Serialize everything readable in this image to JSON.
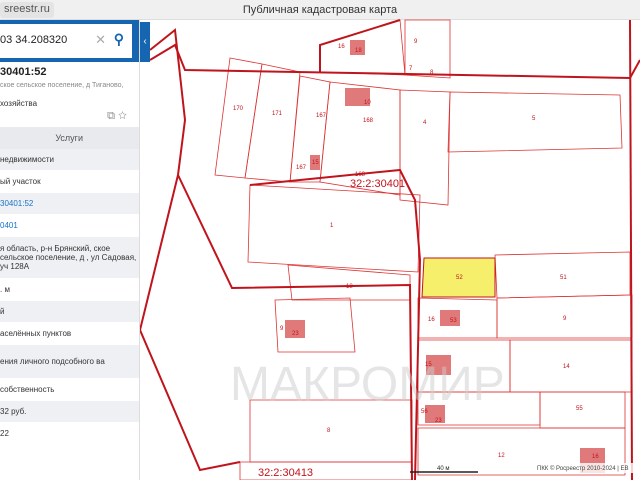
{
  "browser": {
    "url": "sreestr.ru",
    "title": "Публичная кадастровая карта"
  },
  "search": {
    "value": "03 34.208320",
    "clear_icon": "close-icon",
    "search_icon": "search-icon",
    "collapse_icon": "chevron-left-icon"
  },
  "object": {
    "number": "30401:52",
    "address": "ское сельское поселение, д Тиганово,",
    "use": "хозяйства",
    "services_tab": "Услуги"
  },
  "rows": [
    {
      "text": "недвижимости",
      "style": "normal"
    },
    {
      "text": "ый участок",
      "style": "normal"
    },
    {
      "text": "30401:52",
      "style": "link"
    },
    {
      "text": "0401",
      "style": "link"
    },
    {
      "text": "я область, р-н Брянский, ское сельское поселение, д , ул Садовая, уч 128А",
      "style": "normal"
    },
    {
      "text": ". м",
      "style": "normal"
    },
    {
      "text": "й",
      "style": "normal"
    },
    {
      "text": "аселённых пунктов",
      "style": "normal"
    },
    {
      "text": "ения личного подсобного ва",
      "style": "normal"
    },
    {
      "text": "собственность",
      "style": "normal"
    },
    {
      "text": "32 руб.",
      "style": "normal"
    },
    {
      "text": "22",
      "style": "normal"
    }
  ],
  "map": {
    "quarters": [
      "32:2:30401",
      "32:2:30413"
    ],
    "parcel_labels": [
      "16",
      "18",
      "9",
      "7",
      "8",
      "170",
      "171",
      "167",
      "168",
      "10",
      "4",
      "5",
      "167",
      "15",
      "168",
      "1",
      "52",
      "51",
      "18",
      "16",
      "53",
      "9",
      "9",
      "23",
      "15",
      "14",
      "56",
      "23",
      "55",
      "8",
      "12",
      "16"
    ],
    "scale": "40 м",
    "copyright": "ПКК © Росреестр 2010-2024 | ЕВ",
    "watermark": "МАКРОМИР",
    "selected_color": "#f5ef6b",
    "boundary_color": "#c0141c"
  }
}
